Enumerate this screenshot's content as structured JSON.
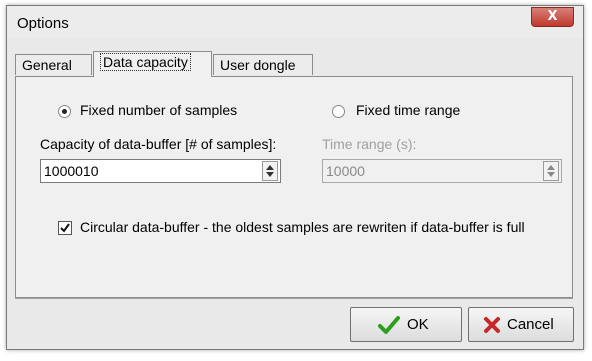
{
  "window": {
    "title": "Options",
    "close_glyph": "X"
  },
  "tabs": [
    {
      "label": "General",
      "active": false
    },
    {
      "label": "Data capacity",
      "active": true
    },
    {
      "label": "User dongle",
      "active": false
    }
  ],
  "mode": {
    "fixed_samples_label": "Fixed number of samples",
    "fixed_samples_selected": true,
    "fixed_time_label": "Fixed time range",
    "fixed_time_selected": false
  },
  "capacity": {
    "label": "Capacity of data-buffer [# of samples]:",
    "value": "1000010"
  },
  "time_range": {
    "label": "Time range (s):",
    "value": "10000",
    "enabled": false
  },
  "circular": {
    "label": "Circular data-buffer - the oldest samples are rewriten if data-buffer is full",
    "checked": true
  },
  "buttons": {
    "ok_label": "OK",
    "cancel_label": "Cancel"
  },
  "colors": {
    "ok_check": "#2e9e1f",
    "cancel_x": "#c62828",
    "close_button": "#c0392b"
  },
  "icons": {
    "ok": "checkmark-icon",
    "cancel": "x-icon",
    "close": "close-icon"
  }
}
